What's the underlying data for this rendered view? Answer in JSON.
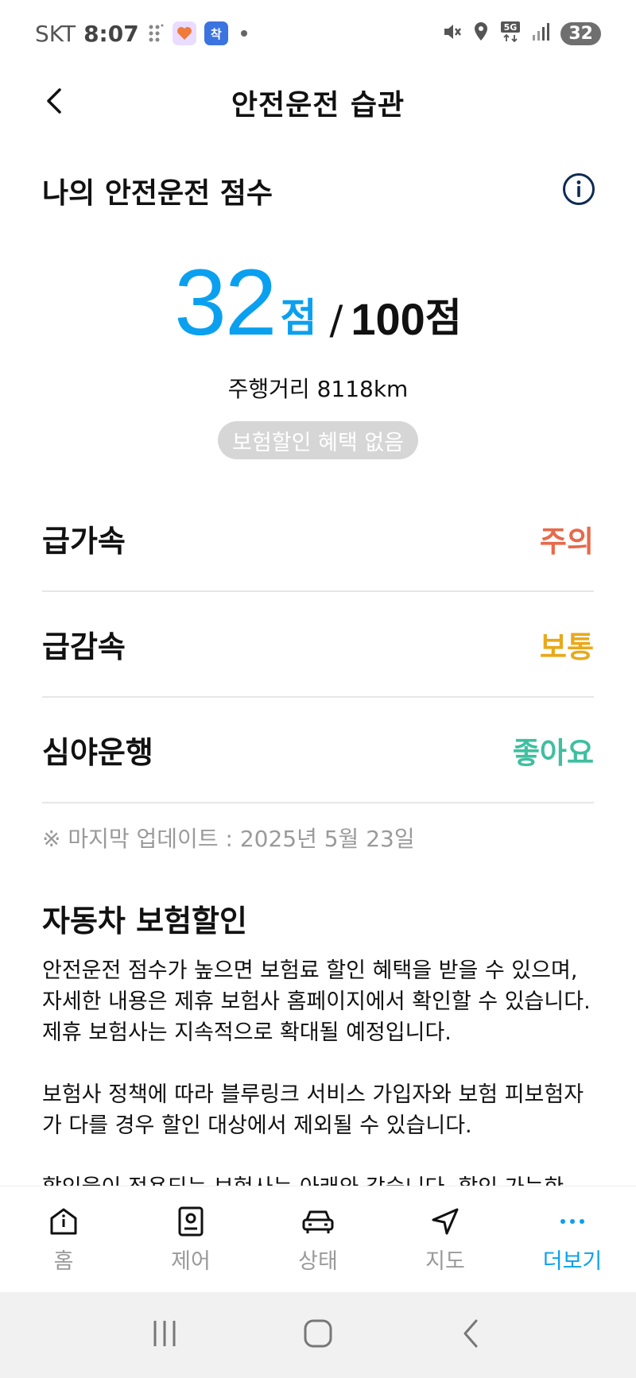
{
  "status_bar": {
    "carrier": "SKT",
    "time": "8:07",
    "app_badge": "착",
    "battery": "32"
  },
  "header": {
    "title": "안전운전 습관"
  },
  "score": {
    "heading": "나의 안전운전 점수",
    "value": "32",
    "unit": "점",
    "separator": "/",
    "total": "100",
    "total_unit": "점",
    "distance": "주행거리 8118km",
    "badge": "보험할인 혜택 없음",
    "color": "#0aa0ef"
  },
  "habits": [
    {
      "label": "급가속",
      "status": "주의",
      "color": "#e8694a"
    },
    {
      "label": "급감속",
      "status": "보통",
      "color": "#e8a91a"
    },
    {
      "label": "심야운행",
      "status": "좋아요",
      "color": "#3fbfa0"
    }
  ],
  "update_note": "※ 마지막 업데이트 : 2025년 5월 23일",
  "insurance": {
    "title": "자동차 보험할인",
    "paragraphs": [
      "안전운전 점수가 높으면 보험료 할인 혜택을 받을 수 있으며, 자세한 내용은 제휴 보험사 홈페이지에서 확인할 수 있습니다. 제휴 보험사는 지속적으로 확대될 예정입니다.",
      "보험사 정책에 따라 블루링크 서비스 가입자와 보험 피보험자가 다를 경우 할인 대상에서 제외될 수 있습니다.",
      "할인율이 적용되는 보험사는 아래와 같습니다. 할인 가능한"
    ]
  },
  "bottom_nav": [
    {
      "label": "홈",
      "icon": "home-icon"
    },
    {
      "label": "제어",
      "icon": "control-icon"
    },
    {
      "label": "상태",
      "icon": "car-status-icon"
    },
    {
      "label": "지도",
      "icon": "map-navigation-icon"
    },
    {
      "label": "더보기",
      "icon": "more-icon",
      "active": true
    }
  ],
  "colors": {
    "accent": "#0aa0ef",
    "muted": "#9a9a9a"
  }
}
